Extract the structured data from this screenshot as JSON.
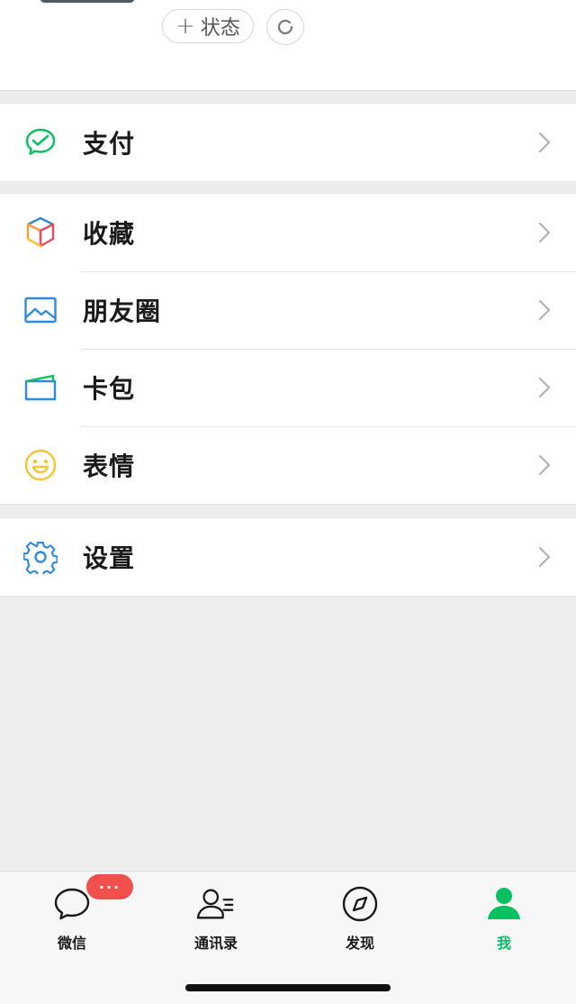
{
  "profile": {
    "status_button": {
      "icon": "plus-icon",
      "label": "状态"
    },
    "refresh_button": {
      "icon": "refresh-icon"
    }
  },
  "menu_groups": [
    {
      "items": [
        {
          "label": "支付",
          "icon": "pay-icon",
          "icon_color": "#07c160"
        }
      ]
    },
    {
      "items": [
        {
          "label": "收藏",
          "icon": "favorites-cube-icon",
          "icon_color": "#fa9d3b"
        },
        {
          "label": "朋友圈",
          "icon": "moments-picture-icon",
          "icon_color": "#2f8be0"
        },
        {
          "label": "卡包",
          "icon": "card-wallet-icon",
          "icon_color": "#2f8be0"
        },
        {
          "label": "表情",
          "icon": "sticker-smile-icon",
          "icon_color": "#f7c331"
        }
      ]
    },
    {
      "items": [
        {
          "label": "设置",
          "icon": "settings-gear-icon",
          "icon_color": "#2f8be0"
        }
      ]
    }
  ],
  "tabbar": {
    "badge": "···",
    "tabs": [
      {
        "label": "微信",
        "icon": "chat-bubble-icon",
        "active": false
      },
      {
        "label": "通讯录",
        "icon": "contacts-icon",
        "active": false
      },
      {
        "label": "发现",
        "icon": "compass-icon",
        "active": false
      },
      {
        "label": "我",
        "icon": "person-icon",
        "active": true
      }
    ],
    "active_color": "#07c160"
  }
}
